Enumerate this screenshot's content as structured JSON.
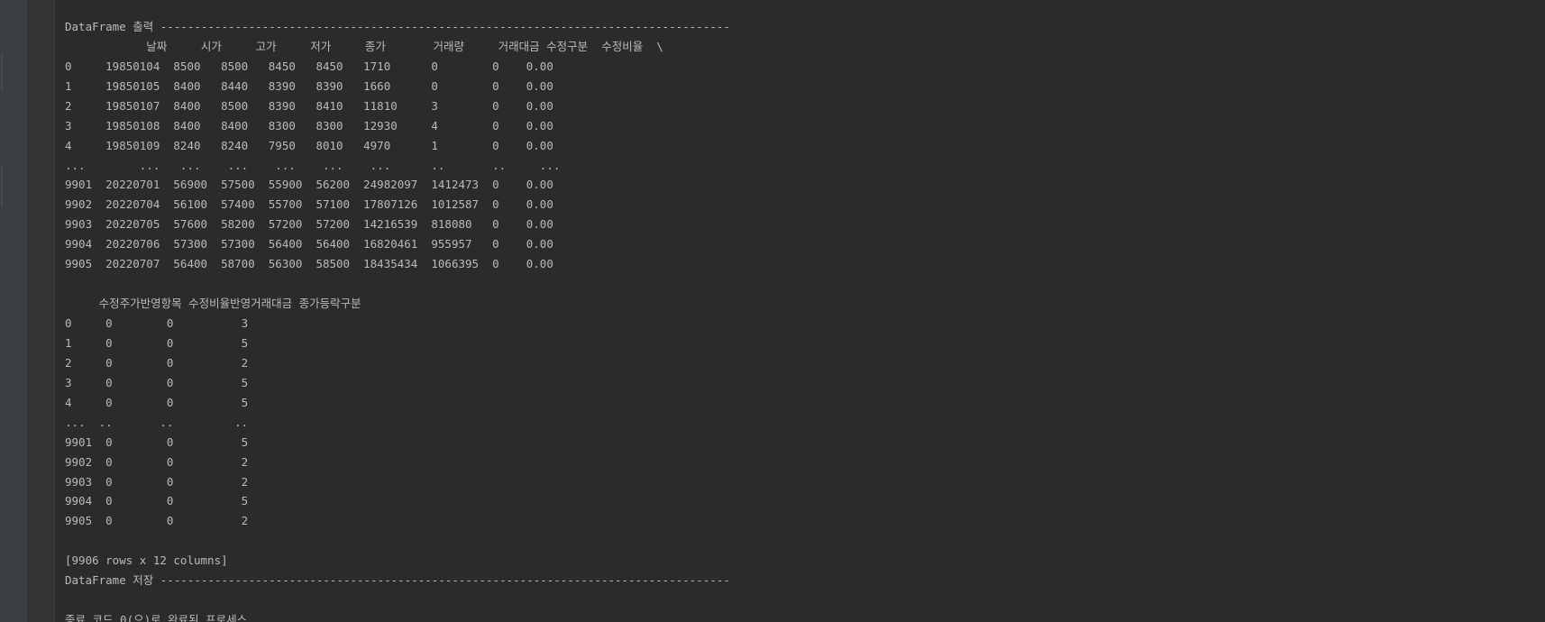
{
  "console": {
    "lines": [
      "",
      "DataFrame 출력 ------------------------------------------------------------------------------------",
      "            날짜     시가     고가     저가     종가       거래량     거래대금 수정구분  수정비율  \\",
      "0     19850104  8500   8500   8450   8450   1710      0        0    0.00",
      "1     19850105  8400   8440   8390   8390   1660      0        0    0.00",
      "2     19850107  8400   8500   8390   8410   11810     3        0    0.00",
      "3     19850108  8400   8400   8300   8300   12930     4        0    0.00",
      "4     19850109  8240   8240   7950   8010   4970      1        0    0.00",
      "...        ...   ...    ...    ...    ...    ...      ..       ..     ...",
      "9901  20220701  56900  57500  55900  56200  24982097  1412473  0    0.00",
      "9902  20220704  56100  57400  55700  57100  17807126  1012587  0    0.00",
      "9903  20220705  57600  58200  57200  57200  14216539  818080   0    0.00",
      "9904  20220706  57300  57300  56400  56400  16820461  955957   0    0.00",
      "9905  20220707  56400  58700  56300  58500  18435434  1066395  0    0.00",
      "",
      "     수정주가반영항목 수정비율반영거래대금 종가등락구분",
      "0     0        0          3",
      "1     0        0          5",
      "2     0        0          2",
      "3     0        0          5",
      "4     0        0          5",
      "...  ..       ..         ..",
      "9901  0        0          5",
      "9902  0        0          2",
      "9903  0        0          2",
      "9904  0        0          5",
      "9905  0        0          2",
      "",
      "[9906 rows x 12 columns]",
      "DataFrame 저장 ------------------------------------------------------------------------------------",
      "",
      "종료 코드 0(으)로 완료된 프로세스"
    ]
  },
  "colors": {
    "background": "#2b2b2b",
    "text": "#bbbbbb",
    "gutter": "#313335",
    "toolstrip": "#3c3f41"
  }
}
